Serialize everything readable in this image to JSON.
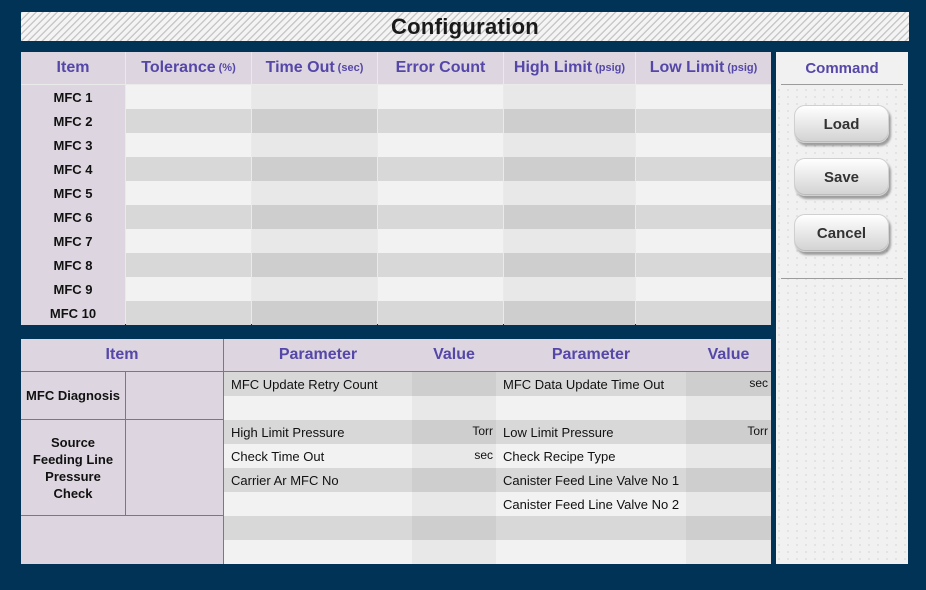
{
  "title": "Configuration",
  "mfc_table": {
    "headers": [
      {
        "label": "Item",
        "unit": ""
      },
      {
        "label": "Tolerance",
        "unit": "(%)"
      },
      {
        "label": "Time Out",
        "unit": "(sec)"
      },
      {
        "label": "Error Count",
        "unit": ""
      },
      {
        "label": "High Limit",
        "unit": "(psig)"
      },
      {
        "label": "Low Limit",
        "unit": "(psig)"
      }
    ],
    "rows": [
      "MFC 1",
      "MFC 2",
      "MFC 3",
      "MFC 4",
      "MFC 5",
      "MFC 6",
      "MFC 7",
      "MFC 8",
      "MFC 9",
      "MFC 10"
    ]
  },
  "lower_table": {
    "headers": {
      "item": "Item",
      "parameter_left": "Parameter",
      "value_left": "Value",
      "parameter_right": "Parameter",
      "value_right": "Value"
    },
    "groups": {
      "mfc_diagnosis": {
        "label": "MFC Diagnosis",
        "left": [
          {
            "param": "MFC Update Retry Count",
            "unit": ""
          },
          {
            "param": "",
            "unit": ""
          }
        ],
        "right": [
          {
            "param": "MFC Data Update Time Out",
            "unit": "sec"
          },
          {
            "param": "",
            "unit": ""
          }
        ]
      },
      "source_feeding": {
        "label": "Source Feeding Line Pressure Check",
        "left": [
          {
            "param": "High Limit Pressure",
            "unit": "Torr"
          },
          {
            "param": "Check Time Out",
            "unit": "sec"
          },
          {
            "param": "Carrier Ar MFC No",
            "unit": ""
          },
          {
            "param": "",
            "unit": ""
          }
        ],
        "right": [
          {
            "param": "Low Limit Pressure",
            "unit": "Torr"
          },
          {
            "param": "Check Recipe Type",
            "unit": ""
          },
          {
            "param": "Canister Feed Line Valve No 1",
            "unit": ""
          },
          {
            "param": "Canister Feed Line Valve No 2",
            "unit": ""
          }
        ]
      }
    }
  },
  "command": {
    "title": "Command",
    "load": "Load",
    "save": "Save",
    "cancel": "Cancel"
  }
}
